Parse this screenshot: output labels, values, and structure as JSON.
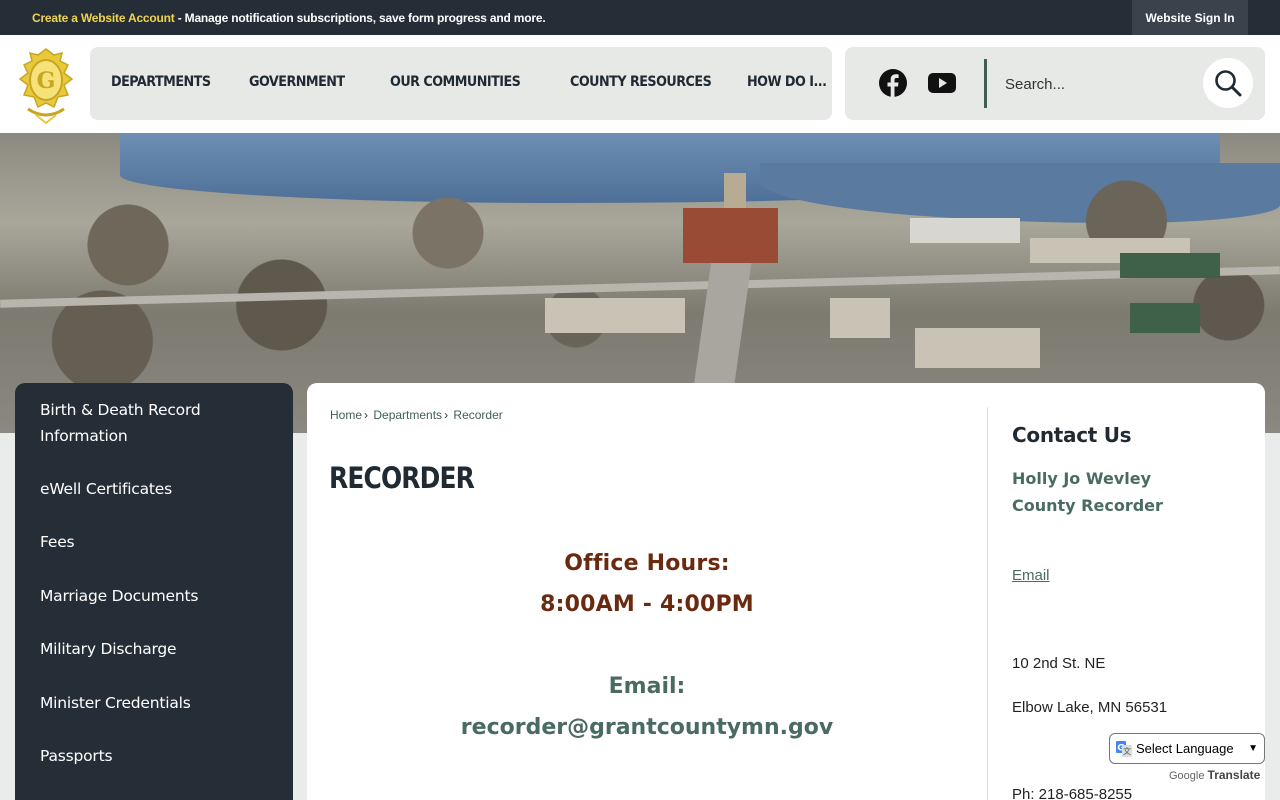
{
  "topbar": {
    "create_account": "Create a Website Account",
    "message": " - Manage notification subscriptions, save form progress and more.",
    "sign_in": "Website Sign In"
  },
  "nav": {
    "items": [
      "DEPARTMENTS",
      "GOVERNMENT",
      "OUR COMMUNITIES",
      "COUNTY RESOURCES",
      "HOW DO I..."
    ]
  },
  "search": {
    "placeholder": "Search..."
  },
  "icons": {
    "logo": "county-seal-icon",
    "facebook": "facebook-icon",
    "youtube": "youtube-icon",
    "search": "search-icon"
  },
  "sidebar": {
    "items": [
      "Birth & Death Record Information",
      "eWell Certificates",
      "Fees",
      "Marriage Documents",
      "Military Discharge",
      "Minister Credentials",
      "Passports"
    ]
  },
  "breadcrumb": {
    "home": "Home",
    "departments": "Departments",
    "current": "Recorder"
  },
  "page": {
    "title": "RECORDER",
    "hours_label": "Office Hours:",
    "hours_value": "8:00AM - 4:00PM",
    "email_label": "Email:",
    "email_value": "recorder@grantcountymn.gov"
  },
  "contact": {
    "title": "Contact Us",
    "name": "Holly Jo Wevley",
    "role": "County Recorder",
    "email_link": "Email",
    "address_line1": "10 2nd St. NE",
    "address_line2": "Elbow Lake, MN 56531",
    "phone": "Ph: 218-685-8255"
  },
  "translate": {
    "select_label": "Select Language",
    "powered_by": "Google",
    "translate_word": "Translate"
  },
  "colors": {
    "dark_navy": "#252e37",
    "gold": "#f1d44b",
    "green_accent": "#4a6b63",
    "rust": "#6a2a10"
  }
}
